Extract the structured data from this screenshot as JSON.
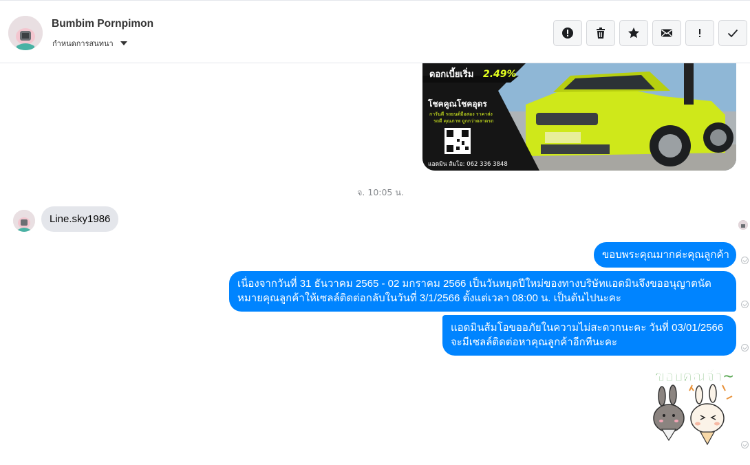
{
  "header": {
    "contact_name": "Bumbim Pornpimon",
    "settings_label": "กำหนดการสนทนา",
    "toolbar": [
      {
        "name": "report-button",
        "icon": "alert-circle-icon"
      },
      {
        "name": "delete-button",
        "icon": "trash-icon"
      },
      {
        "name": "star-button",
        "icon": "star-icon"
      },
      {
        "name": "mark-unread-button",
        "icon": "envelope-icon"
      },
      {
        "name": "mark-important-button",
        "icon": "exclamation-icon"
      },
      {
        "name": "mark-done-button",
        "icon": "check-icon"
      }
    ]
  },
  "image_message": {
    "promo_rate_prefix": "ดอกเบี้ยเริ่ม",
    "promo_rate": "2.49%",
    "brand_title": "โชคคูณโชคอุดร",
    "brand_line1": "การันตี รถยนต์มือสอง ราคาส่ง",
    "brand_line2": "รถดี คุณภาพ ถูกกว่าตลาดรถ",
    "contact": "แอดมิน ส้มโอ: 062 336 3848",
    "accent_color": "#e3ff1f"
  },
  "timestamp": "จ. 10:05 น.",
  "messages": {
    "incoming": "Line.sky1986",
    "out1": "ขอบพระคุณมากค่ะคุณลูกค้า",
    "out2_line1": "เนื่องจากวันที่ 31 ธันวาคม 2565 - 02 มกราคม 2566 เป็นวันหยุดปีใหม่ของทางบริษัทแอดมินจึงขออนุญาตนัด",
    "out2_line2": "หมายคุณลูกค้าให้เซลล์ติดต่อกลับในวันที่  3/1/2566  ตั้งแต่เวลา 08:00 น. เป็นต้นไปนะคะ",
    "out3_line1": "แอดมินส้มโอขออภัยในความไม่สะดวกนะคะ วันที่ 03/01/2566",
    "out3_line2": "จะมีเซลล์ติดต่อหาคุณลูกค้าอีกทีนะคะ"
  },
  "sticker": {
    "text": "ขอบคุณจ้า~",
    "text_color": "#5aa854"
  },
  "colors": {
    "outgoing_bubble": "#0084ff",
    "incoming_bubble": "#e4e6eb"
  }
}
